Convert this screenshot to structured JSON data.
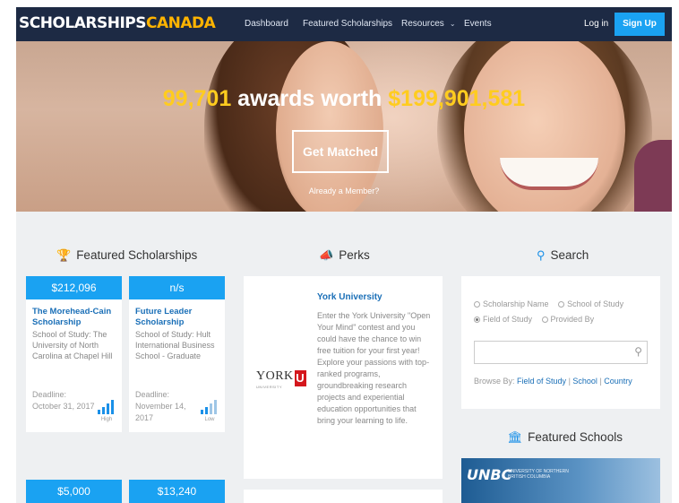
{
  "nav": {
    "logo_part1": "SCHOLARSHIPS",
    "logo_part2": "CANADA",
    "links": [
      "Dashboard",
      "Featured Scholarships",
      "Resources",
      "Events"
    ],
    "login": "Log in",
    "signup": "Sign Up"
  },
  "hero": {
    "count": "99,701",
    "middle": " awards worth ",
    "amount": "$199,901,581",
    "cta": "Get Matched",
    "member": "Already a Member?"
  },
  "featured": {
    "title": "Featured Scholarships",
    "deadline_label": "Deadline:",
    "cards": [
      {
        "amount": "$212,096",
        "name": "The Morehead-Cain Scholarship",
        "school": "School of Study: The University of North Carolina at Chapel Hill",
        "deadline": "October 31, 2017",
        "level": "High",
        "level_value": 4
      },
      {
        "amount": "n/s",
        "name": "Future Leader Scholarship",
        "school": "School of Study: Hult International Business School - Graduate",
        "deadline": "November 14, 2017",
        "level": "Low",
        "level_value": 2
      },
      {
        "amount": "$5,000"
      },
      {
        "amount": "$13,240"
      }
    ]
  },
  "perks": {
    "title": "Perks",
    "org": "York University",
    "logo_text": "YORK",
    "logo_u": "U",
    "logo_sub": "UNIVERSITY",
    "text": "Enter the York University \"Open Your Mind\" contest and you could have the chance to win free tuition for your first year! Explore your passions with top-ranked programs, groundbreaking research projects and experiential education opportunities that bring your learning to life."
  },
  "search": {
    "title": "Search",
    "options": [
      {
        "label": "Scholarship Name",
        "selected": false
      },
      {
        "label": "School of Study",
        "selected": false
      },
      {
        "label": "Field of Study",
        "selected": true
      },
      {
        "label": "Provided By",
        "selected": false
      }
    ],
    "placeholder": "",
    "browse_label": "Browse By:",
    "browse_links": [
      "Field of Study",
      "School",
      "Country"
    ]
  },
  "featured_schools": {
    "title": "Featured Schools",
    "logo_mark": "UNBC",
    "logo_sub": "UNIVERSITY OF NORTHERN BRITISH COLUMBIA"
  },
  "colors": {
    "nav_bg": "#1d2a44",
    "accent": "#1aa2f2",
    "hero_number": "#ffcc1f",
    "logo_highlight": "#ffb400"
  }
}
